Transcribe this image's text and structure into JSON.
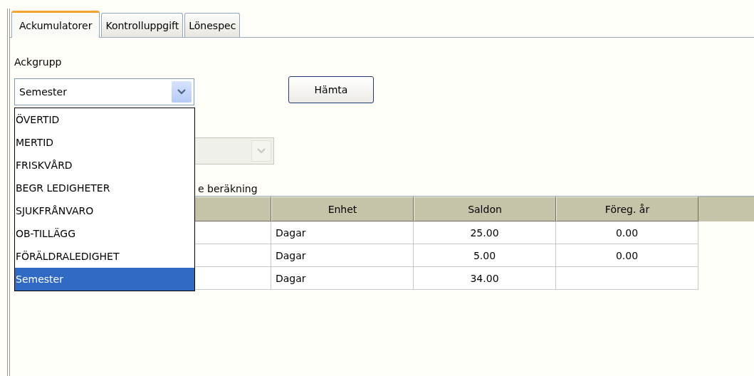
{
  "tabs": [
    {
      "label": "Ackumulatorer",
      "selected": true
    },
    {
      "label": "Kontrolluppgift",
      "selected": false
    },
    {
      "label": "Lönespec",
      "selected": false
    }
  ],
  "ackgrupp": {
    "label": "Ackgrupp",
    "value": "Semester",
    "expanded": true,
    "options": [
      {
        "label": "ÖVERTID",
        "selected": false
      },
      {
        "label": "MERTID",
        "selected": false
      },
      {
        "label": "FRISKVÅRD",
        "selected": false
      },
      {
        "label": "BEGR LEDIGHETER",
        "selected": false
      },
      {
        "label": "SJUKFRÅNVARO",
        "selected": false
      },
      {
        "label": "OB-TILLÄGG",
        "selected": false
      },
      {
        "label": "FÖRÄLDRALEDIGHET",
        "selected": false
      },
      {
        "label": "Semester",
        "selected": true
      }
    ]
  },
  "fetch_button": "Hämta",
  "second_combo": {
    "disabled": true
  },
  "calc_label": "e beräkning",
  "table": {
    "columns": [
      "Enhet",
      "Saldon",
      "Föreg. år"
    ],
    "rows": [
      {
        "enhet": "Dagar",
        "saldon": "25.00",
        "foreg": "0.00"
      },
      {
        "enhet": "Dagar",
        "saldon": "5.00",
        "foreg": "0.00"
      },
      {
        "enhet": "Dagar",
        "saldon": "34.00"
      }
    ]
  }
}
